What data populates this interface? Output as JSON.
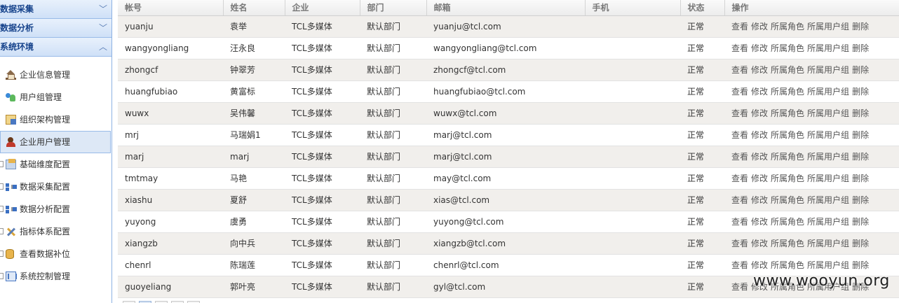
{
  "sidebar": {
    "sections": [
      {
        "label": "数据采集",
        "chevron": "﹀"
      },
      {
        "label": "数据分析",
        "chevron": "﹀"
      },
      {
        "label": "系统环境",
        "chevron": "︿"
      }
    ],
    "items": [
      {
        "label": "企业信息管理",
        "icon": "home-icon"
      },
      {
        "label": "用户组管理",
        "icon": "users-icon"
      },
      {
        "label": "组织架构管理",
        "icon": "org-icon"
      },
      {
        "label": "企业用户管理",
        "icon": "user-icon",
        "active": true
      },
      {
        "label": "基础维度配置",
        "icon": "dimension-icon"
      },
      {
        "label": "数据采集配置",
        "icon": "network-icon"
      },
      {
        "label": "数据分析配置",
        "icon": "network-icon"
      },
      {
        "label": "指标体系配置",
        "icon": "tools-icon"
      },
      {
        "label": "查看数据补位",
        "icon": "database-icon"
      },
      {
        "label": "系统控制管理",
        "icon": "system-icon"
      }
    ]
  },
  "table": {
    "headers": [
      "帐号",
      "姓名",
      "企业",
      "部门",
      "邮箱",
      "手机",
      "状态",
      "操作"
    ],
    "actions": [
      "查看",
      "修改",
      "所属角色",
      "所属用户组",
      "删除"
    ],
    "rows": [
      {
        "account": "yuanju",
        "name": "袁举",
        "company": "TCL多媒体",
        "dept": "默认部门",
        "email": "yuanju@tcl.com",
        "phone": "",
        "status": "正常"
      },
      {
        "account": "wangyongliang",
        "name": "汪永良",
        "company": "TCL多媒体",
        "dept": "默认部门",
        "email": "wangyongliang@tcl.com",
        "phone": "",
        "status": "正常"
      },
      {
        "account": "zhongcf",
        "name": "钟翠芳",
        "company": "TCL多媒体",
        "dept": "默认部门",
        "email": "zhongcf@tcl.com",
        "phone": "",
        "status": "正常"
      },
      {
        "account": "huangfubiao",
        "name": "黄富标",
        "company": "TCL多媒体",
        "dept": "默认部门",
        "email": "huangfubiao@tcl.com",
        "phone": "",
        "status": "正常"
      },
      {
        "account": "wuwx",
        "name": "吴伟馨",
        "company": "TCL多媒体",
        "dept": "默认部门",
        "email": "wuwx@tcl.com",
        "phone": "",
        "status": "正常"
      },
      {
        "account": "mrj",
        "name": "马瑞娟1",
        "company": "TCL多媒体",
        "dept": "默认部门",
        "email": "marj@tcl.com",
        "phone": "",
        "status": "正常"
      },
      {
        "account": "marj",
        "name": "marj",
        "company": "TCL多媒体",
        "dept": "默认部门",
        "email": "marj@tcl.com",
        "phone": "",
        "status": "正常"
      },
      {
        "account": "tmtmay",
        "name": "马艳",
        "company": "TCL多媒体",
        "dept": "默认部门",
        "email": "may@tcl.com",
        "phone": "",
        "status": "正常"
      },
      {
        "account": "xiashu",
        "name": "夏舒",
        "company": "TCL多媒体",
        "dept": "默认部门",
        "email": "xias@tcl.com",
        "phone": "",
        "status": "正常"
      },
      {
        "account": "yuyong",
        "name": "虞勇",
        "company": "TCL多媒体",
        "dept": "默认部门",
        "email": "yuyong@tcl.com",
        "phone": "",
        "status": "正常"
      },
      {
        "account": "xiangzb",
        "name": "向中兵",
        "company": "TCL多媒体",
        "dept": "默认部门",
        "email": "xiangzb@tcl.com",
        "phone": "",
        "status": "正常"
      },
      {
        "account": "chenrl",
        "name": "陈瑞莲",
        "company": "TCL多媒体",
        "dept": "默认部门",
        "email": "chenrl@tcl.com",
        "phone": "",
        "status": "正常"
      },
      {
        "account": "guoyeliang",
        "name": "郭叶亮",
        "company": "TCL多媒体",
        "dept": "默认部门",
        "email": "gyl@tcl.com",
        "phone": "",
        "status": "正常"
      }
    ]
  },
  "watermark": "www.wooyun.org",
  "colors": {
    "sidebar_header": "#15428b",
    "sidebar_border": "#99bbe8",
    "row_alt": "#f1efec"
  }
}
